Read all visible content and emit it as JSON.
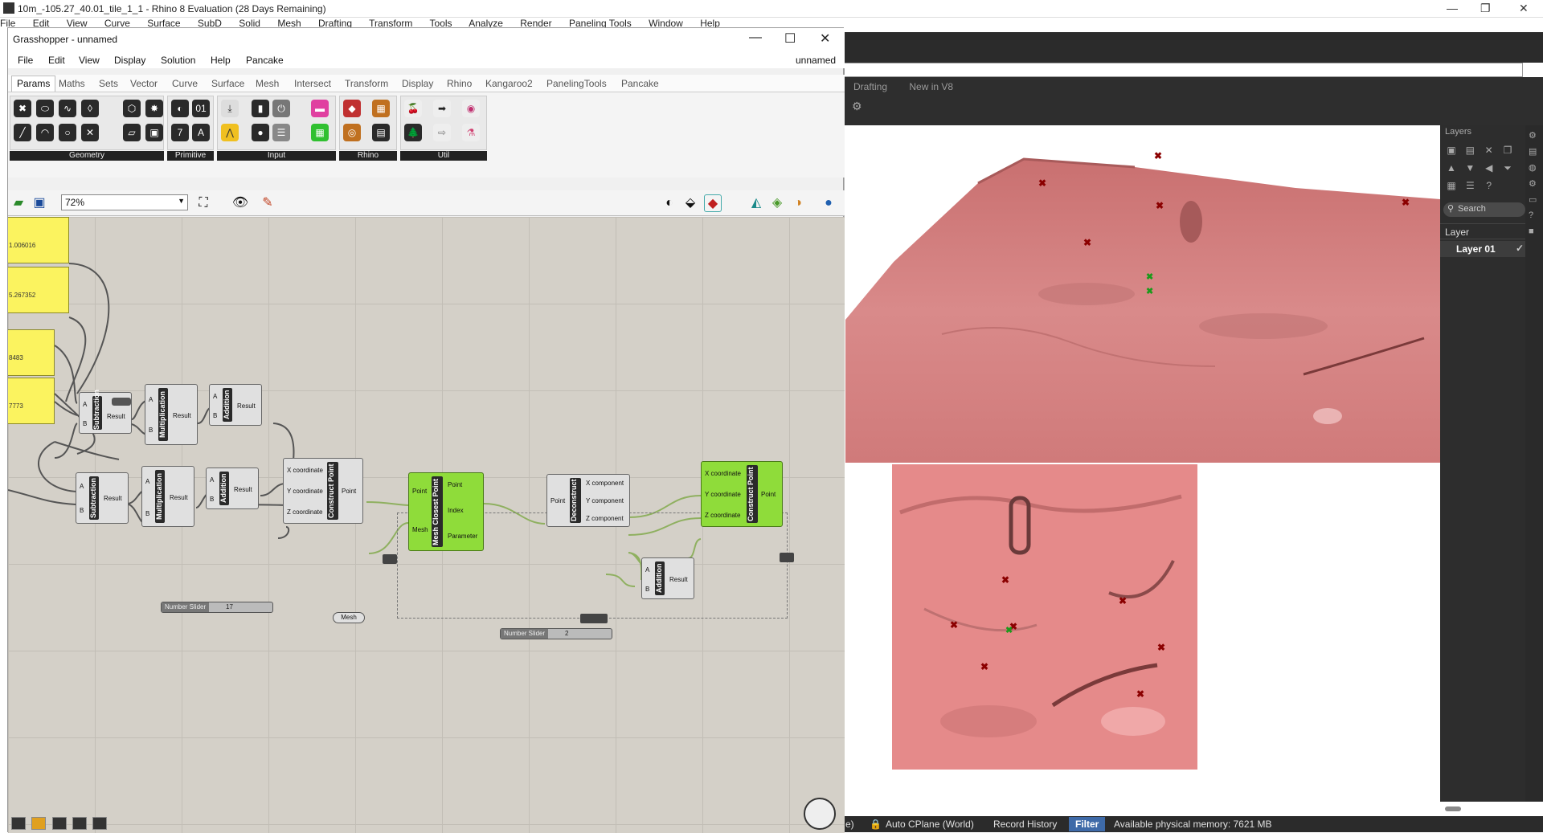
{
  "rhino": {
    "title": "10m_-105.27_40.01_tile_1_1 - Rhino 8 Evaluation (28 Days Remaining)",
    "menu": [
      "File",
      "Edit",
      "View",
      "Curve",
      "Surface",
      "SubD",
      "Solid",
      "Mesh",
      "Drafting",
      "Transform",
      "Tools",
      "Analyze",
      "Render",
      "Paneling Tools",
      "Window",
      "Help"
    ],
    "visible_tabs": [
      "Drafting",
      "New in V8"
    ],
    "layers": {
      "header": "Layers",
      "search_placeholder": "Search",
      "column": "Layer",
      "rows": [
        {
          "name": "Layer 01",
          "current": true
        }
      ]
    },
    "status": {
      "cplane": "Auto CPlane (World)",
      "record_history": "Record History",
      "filter": "Filter",
      "memory": "Available physical memory: 7621 MB",
      "partial_left": "e)"
    }
  },
  "grasshopper": {
    "title": "Grasshopper - unnamed",
    "document_name": "unnamed",
    "menu": [
      "File",
      "Edit",
      "View",
      "Display",
      "Solution",
      "Help",
      "Pancake"
    ],
    "tabs": [
      "Params",
      "Maths",
      "Sets",
      "Vector",
      "Curve",
      "Surface",
      "Mesh",
      "Intersect",
      "Transform",
      "Display",
      "Rhino",
      "Kangaroo2",
      "PanelingTools",
      "Pancake"
    ],
    "active_tab": "Params",
    "ribbon_groups": [
      "Geometry",
      "Primitive",
      "Input",
      "Rhino",
      "Util"
    ],
    "zoom": "72%",
    "canvas": {
      "panels": [
        "1.006016",
        "5.267352",
        "8483",
        "7773"
      ],
      "components": {
        "subtraction": {
          "name": "Subtraction",
          "inputs": [
            "A",
            "B"
          ],
          "output": "Result"
        },
        "multiplication": {
          "name": "Multiplication",
          "inputs": [
            "A",
            "B"
          ],
          "output": "Result"
        },
        "addition": {
          "name": "Addition",
          "inputs": [
            "A",
            "B"
          ],
          "output": "Result"
        },
        "construct_point": {
          "name": "Construct Point",
          "inputs": [
            "X coordinate",
            "Y coordinate",
            "Z coordinate"
          ],
          "output": "Point"
        },
        "mesh_closest_point": {
          "name": "Mesh Closest Point",
          "inputs": [
            "Point",
            "Mesh"
          ],
          "outputs": [
            "Point",
            "Index",
            "Parameter"
          ]
        },
        "deconstruct": {
          "name": "Deconstruct",
          "input": "Point",
          "outputs": [
            "X component",
            "Y component",
            "Z component"
          ]
        }
      },
      "mesh_param": "Mesh",
      "sliders": [
        {
          "label": "Number Slider",
          "value": "17"
        },
        {
          "label": "Number Slider",
          "value": "2"
        }
      ]
    }
  },
  "colors": {
    "terrain": "#d98080",
    "panel_yellow": "#fbf35f",
    "component_green": "#8fdc3a",
    "marker_red": "#8b0000",
    "marker_green": "#1a9a1a"
  }
}
